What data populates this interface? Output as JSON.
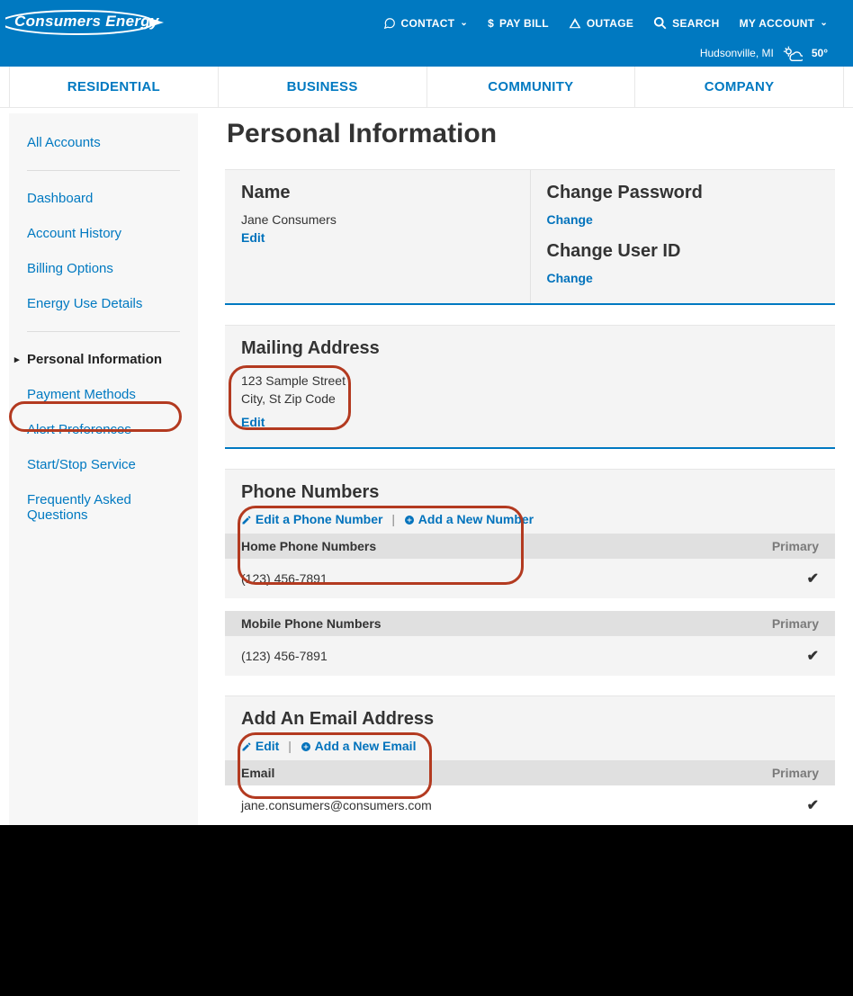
{
  "header": {
    "logo_text": "Consumers Energy",
    "contact": "CONTACT",
    "paybill": "PAY BILL",
    "outage": "OUTAGE",
    "search": "SEARCH",
    "myaccount": "MY ACCOUNT",
    "weather_location": "Hudsonville, MI",
    "weather_temp": "50°"
  },
  "nav": {
    "residential": "RESIDENTIAL",
    "business": "BUSINESS",
    "community": "COMMUNITY",
    "company": "COMPANY"
  },
  "sidebar": {
    "all_accounts": "All Accounts",
    "dashboard": "Dashboard",
    "account_history": "Account History",
    "billing_options": "Billing Options",
    "energy_use": "Energy Use Details",
    "personal_info": "Personal Information",
    "payment_methods": "Payment Methods",
    "alert_prefs": "Alert Preferences",
    "start_stop": "Start/Stop Service",
    "faq": "Frequently Asked Questions"
  },
  "page": {
    "title": "Personal Information",
    "name_head": "Name",
    "name_value": "Jane Consumers",
    "edit": "Edit",
    "change_pw_head": "Change Password",
    "change": "Change",
    "change_uid_head": "Change User ID",
    "mailing_head": "Mailing Address",
    "addr_line1": "123 Sample Street",
    "addr_line2": "City, St Zip Code",
    "phones_head": "Phone Numbers",
    "edit_phone": "Edit a Phone Number",
    "add_phone": "Add a New Number",
    "home_phones_head": "Home Phone Numbers",
    "primary": "Primary",
    "home_phone": "(123) 456-7891",
    "mobile_phones_head": "Mobile Phone Numbers",
    "mobile_phone": "(123) 456-7891",
    "email_head": "Add An Email Address",
    "edit_email": "Edit",
    "add_email": "Add a New Email",
    "email_label": "Email",
    "email_value": "jane.consumers@consumers.com"
  }
}
